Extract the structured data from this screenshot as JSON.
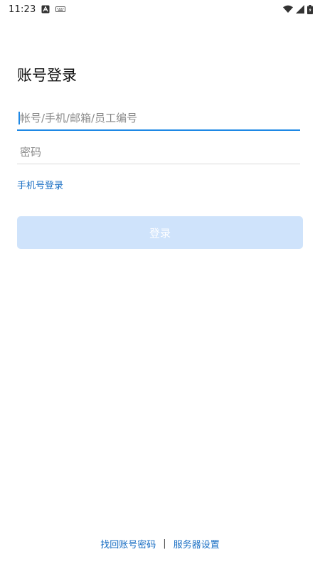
{
  "status_bar": {
    "time": "11:23",
    "icons": [
      "notification-a-icon",
      "keyboard-icon",
      "wifi-icon",
      "signal-icon",
      "battery-icon"
    ]
  },
  "login": {
    "title": "账号登录",
    "account_placeholder": "帐号/手机/邮箱/员工编号",
    "password_placeholder": "密码",
    "phone_login_label": "手机号登录",
    "login_button_label": "登录"
  },
  "footer": {
    "recover_label": "找回账号密码",
    "divider": "|",
    "server_settings_label": "服务器设置"
  },
  "colors": {
    "accent": "#1e88e5",
    "link": "#1a6fc4",
    "button_disabled_bg": "#cfe3fb"
  }
}
